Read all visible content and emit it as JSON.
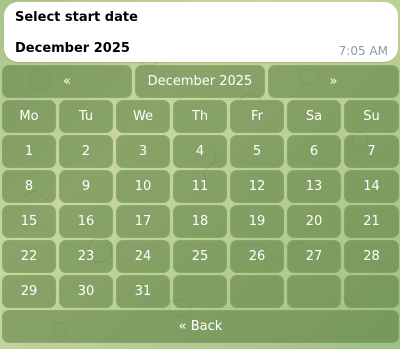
{
  "message": {
    "title": "Select start date",
    "subtitle": "December 2025",
    "time": "7:05 AM"
  },
  "nav": {
    "prev": "«",
    "month": "December 2025",
    "next": "»"
  },
  "weekdays": [
    "Mo",
    "Tu",
    "We",
    "Th",
    "Fr",
    "Sa",
    "Su"
  ],
  "weeks": [
    [
      "1",
      "2",
      "3",
      "4",
      "5",
      "6",
      "7"
    ],
    [
      "8",
      "9",
      "10",
      "11",
      "12",
      "13",
      "14"
    ],
    [
      "15",
      "16",
      "17",
      "18",
      "19",
      "20",
      "21"
    ],
    [
      "22",
      "23",
      "24",
      "25",
      "26",
      "27",
      "28"
    ],
    [
      "29",
      "30",
      "31",
      "",
      "",
      "",
      ""
    ]
  ],
  "back": "« Back",
  "colors": {
    "button": "#56783c",
    "bubble": "#ffffff",
    "time": "#8a9aa8"
  }
}
